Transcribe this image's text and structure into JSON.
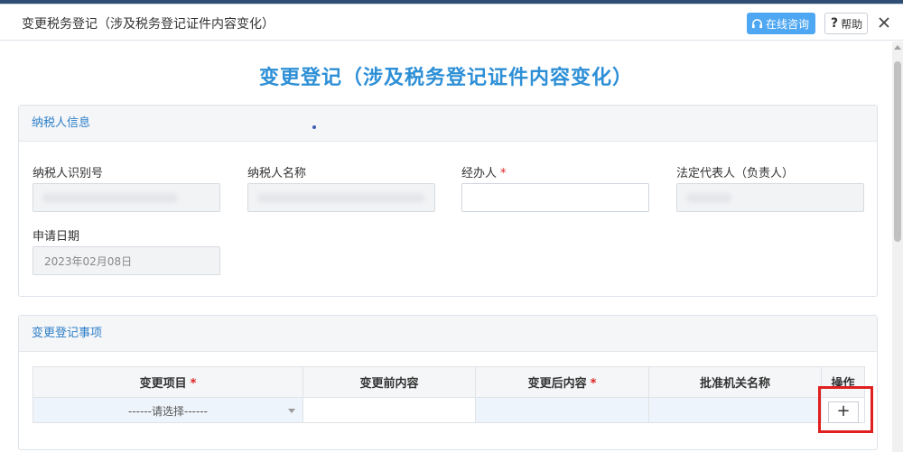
{
  "dialog": {
    "title": "变更税务登记（涉及税务登记证件内容变化）",
    "consult_label": "在线咨询",
    "help_label": "帮助"
  },
  "page": {
    "title": "变更登记（涉及税务登记证件内容变化）"
  },
  "taxpayer_section": {
    "heading": "纳税人信息",
    "fields": [
      {
        "label": "纳税人识别号",
        "value": ""
      },
      {
        "label": "纳税人名称",
        "value": ""
      },
      {
        "label": "经办人",
        "value": "",
        "required_mark": "*"
      },
      {
        "label": "法定代表人（负责人）",
        "value": ""
      },
      {
        "label": "申请日期",
        "value": "2023年02月08日"
      }
    ]
  },
  "change_section": {
    "heading": "变更登记事项",
    "columns": [
      {
        "label": "变更项目",
        "required_mark": "*"
      },
      {
        "label": "变更前内容",
        "required_mark": ""
      },
      {
        "label": "变更后内容",
        "required_mark": "*"
      },
      {
        "label": "批准机关名称",
        "required_mark": ""
      },
      {
        "label": "操作",
        "required_mark": ""
      }
    ],
    "row": {
      "select_placeholder": "------请选择------",
      "add_label": "+"
    }
  },
  "colors": {
    "accent": "#2d8fd6",
    "section_heading": "#2d7fc8",
    "consult_button": "#4ea7f2",
    "required": "#e02020",
    "highlight": "#e02020"
  },
  "icons": {
    "consult": "headset-icon",
    "help": "question-icon",
    "close": "close-icon",
    "dropdown": "caret-down-icon"
  }
}
